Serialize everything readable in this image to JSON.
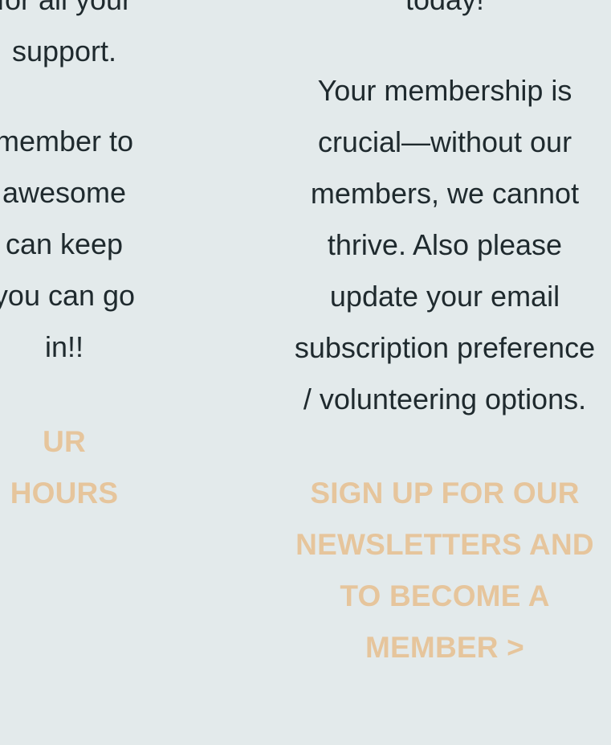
{
  "left_column": {
    "paragraph_1": [
      "for all your",
      "support."
    ],
    "paragraph_2": [
      "member to",
      "awesome",
      "can keep",
      "you can go",
      "in!!"
    ],
    "cta": [
      "UR",
      "HOURS"
    ]
  },
  "right_column": {
    "paragraph_1": [
      "today!"
    ],
    "paragraph_2": [
      "Your membership is",
      "crucial—without our",
      "members, we cannot",
      "thrive.  Also please",
      "update your email",
      "subscription preference",
      "/ volunteering options."
    ],
    "cta": [
      "SIGN UP FOR OUR",
      "NEWSLETTERS AND",
      "TO BECOME A",
      "MEMBER >"
    ]
  },
  "colors": {
    "background": "#e3eaeb",
    "text": "#1f2a2e",
    "cta": "#e6c59c"
  }
}
